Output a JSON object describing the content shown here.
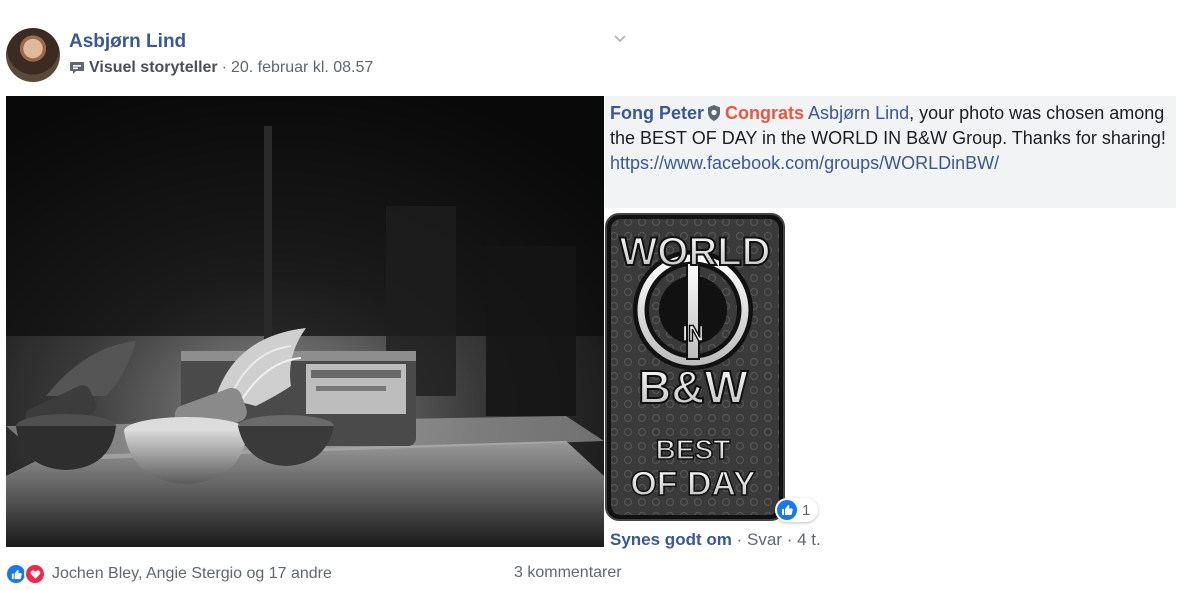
{
  "post": {
    "author": "Asbjørn Lind",
    "badge": "Visuel storyteller",
    "separator": "·",
    "timestamp": "20. februar kl. 08.57"
  },
  "comment": {
    "author": "Fong Peter",
    "highlight": "Congrats",
    "mention": "Asbjørn Lind",
    "text": ", your photo was chosen among the BEST OF DAY in the WORLD IN B&W Group. Thanks for sharing!",
    "link": "https://www.facebook.com/groups/WORLDinBW/",
    "sticker": {
      "line1": "WORLD",
      "line2": "IN",
      "line3": "B&W",
      "line4": "BEST",
      "line5": "OF DAY"
    },
    "reaction_count": "1",
    "like_label": "Synes godt om",
    "reply_label": "Svar",
    "age": "4 t.",
    "sep": "·"
  },
  "footer": {
    "reactors": "Jochen Bley, Angie Stergio og 17 andre",
    "comments": "3 kommentarer"
  },
  "colors": {
    "link": "#385898",
    "congrats": "#e9573f",
    "like": "#1877f2",
    "love": "#f0284a"
  },
  "icons": [
    "speech-bubble-icon",
    "chevron-down-icon",
    "shield-badge-icon",
    "like-icon",
    "heart-icon"
  ]
}
